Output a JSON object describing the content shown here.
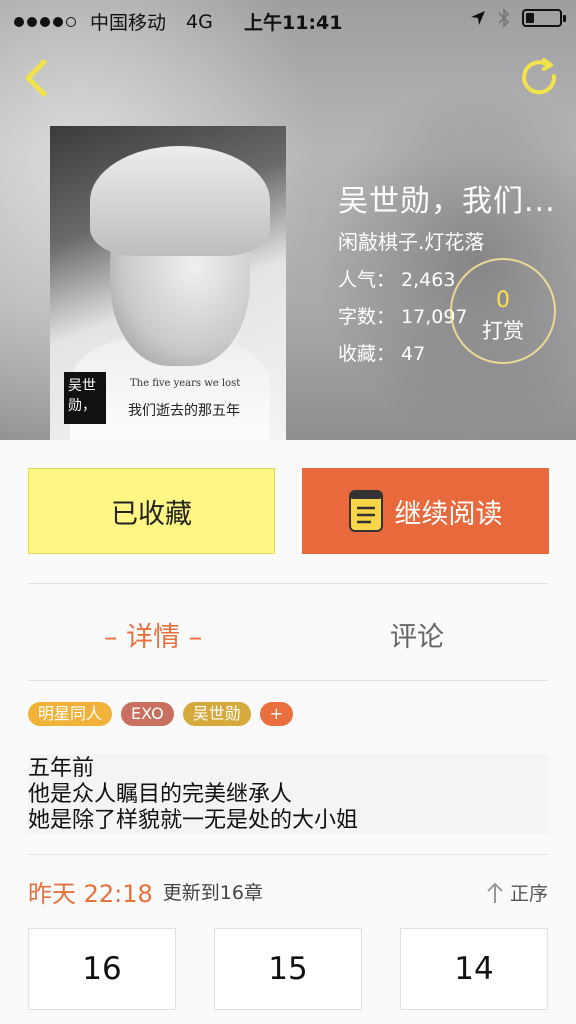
{
  "status_bar": {
    "carrier": "中国移动",
    "network": "4G",
    "time": "上午11:41",
    "battery_level": 0.25
  },
  "colors": {
    "accent": "#e8703c",
    "favorite_bg": "#fff684",
    "read_bg": "#e86a3c",
    "tip_count": "#ffe14a"
  },
  "icons": {
    "back": "chevron-left-icon",
    "refresh": "refresh-icon",
    "book": "book-icon",
    "sort": "arrow-up-icon"
  },
  "book": {
    "title": "吴世勋，我们...",
    "author": "闲敲棋子.灯花落",
    "popularity_label": "人气：",
    "popularity": "2,463",
    "words_label": "字数：",
    "words": "17,097",
    "favorites_label": "收藏：",
    "favorites": "47",
    "tip_count": "0",
    "tip_label": "打赏",
    "cover": {
      "stamp_line1": "吴世",
      "stamp_line2": "勋，",
      "subtitle_en": "The five years we lost",
      "subtitle_cn": "我们逝去的那五年"
    }
  },
  "actions": {
    "favorited_label": "已收藏",
    "continue_label": "继续阅读"
  },
  "tabs": {
    "detail": "– 详情 –",
    "comments": "评论"
  },
  "tags": [
    {
      "label": "明星同人",
      "color": "#f1b23a"
    },
    {
      "label": "EXO",
      "color": "#c97060"
    },
    {
      "label": "吴世勋",
      "color": "#d6a93c"
    },
    {
      "label": "+",
      "color": "#ea6f3e"
    }
  ],
  "summary": [
    "五年前",
    "他是众人瞩目的完美继承人",
    "她是除了样貌就一无是处的大小姐"
  ],
  "update": {
    "when": "昨天 22:18",
    "what": "更新到16章",
    "order": "正序"
  },
  "chapters": [
    "16",
    "15",
    "14"
  ]
}
